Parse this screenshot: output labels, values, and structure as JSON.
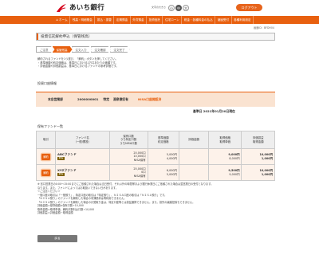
{
  "header": {
    "bank_name": "あいち銀行",
    "font_size_label": "文字の大きさ",
    "font_sizes": [
      "小",
      "中",
      "大"
    ],
    "logout_label": "ログアウト"
  },
  "nav": {
    "items": [
      "ホーム",
      "残高・明細照会",
      "振込・振替",
      "定期預金",
      "外貨預金",
      "投資信託",
      "住宅ローン",
      "税金・各種料金の払込",
      "諸届受付",
      "各種利用設定"
    ]
  },
  "screen_id": "画面ID：BFDH04",
  "page_title": "投資信託解約申込（保管残高）",
  "steps": [
    "ご注意",
    "保管残高",
    "注文入力",
    "注文確認",
    "注文完了"
  ],
  "intro_notes": [
    "解約されるファンドを1つ選び、「解約」ボタンを押してください。",
    "・基準価額や約定価格は、基準日における1万口あたりの価額です。",
    "・評価金額や評価損益は、基準日におけるファンドの参考評価です。"
  ],
  "account_section_title": "投資口座情報",
  "account": {
    "branch": "本店営業部",
    "number": "2000000001",
    "type": "特定",
    "name": "源泉徴収有",
    "nisa": "NISA口座開設済"
  },
  "base_date": "基準日 2021年01月20日現在",
  "funds_section_title": "保有ファンド一覧",
  "table": {
    "headers": [
      "取引",
      "ファンド名\n（一般/累投）",
      "保有口数\nうち特定口数\nうちNISA口数",
      "基準価額\n約定価格",
      "評価金額",
      "取得価格\n取得単価",
      "評価損益\n取得金額"
    ],
    "rows": [
      {
        "action": "解約",
        "name": "ABCファンド",
        "status": "累投",
        "units": "20,000口",
        "units_specified": "10,000口",
        "units_nisa": "NISA保有",
        "price": "5,000円",
        "price_contract": "4,000円",
        "value": "",
        "acq_price": "9,000円",
        "acq_unit": "8,000円",
        "gain": "10,000円",
        "gain_total": "1,000円"
      },
      {
        "action": "解約",
        "name": "XYZファンド",
        "status": "累投",
        "units": "25,000口",
        "units_specified": "0口",
        "units_nisa": "NISA保有",
        "price": "6,000円",
        "price_contract": "5,000円",
        "value": "",
        "acq_price": "9,500円",
        "acq_unit": "9,000円",
        "gain": "10,000円",
        "gain_total": "1,000円"
      }
    ]
  },
  "footer_notes": [
    "※ 窓口営業日の0:00～15:00までにご依頼された場合は当日受付、それ以外の時間帯および銀行休業日にご依頼された場合は翌営業日の受付となります。",
    "  なります。また、ファンドによってはお取扱いできない日があります。",
    "＜ご注意ください＞",
    "一般口座の取引は「一般預り」、特定口座の取引は「特定預り」、ＮＩＳＡ口座の取引は「ＮＩＳＡ預り」です。",
    "「ＮＩＳＡ預り」のファンドを解約した場合の非課税枠は再利用できません。",
    "「ＮＩＳＡ預り」のファンドを解約した場合のお受取り金は、特定口座等とは損益通算できません。また、損失の繰越控除もできません。",
    "評価金額＝基準価額×保有口数÷10,000",
    "取得金額＝取得単価、解約手数料は口数÷10,000",
    "評価損益＝評価金額－取得金額"
  ],
  "back_label": "戻る"
}
